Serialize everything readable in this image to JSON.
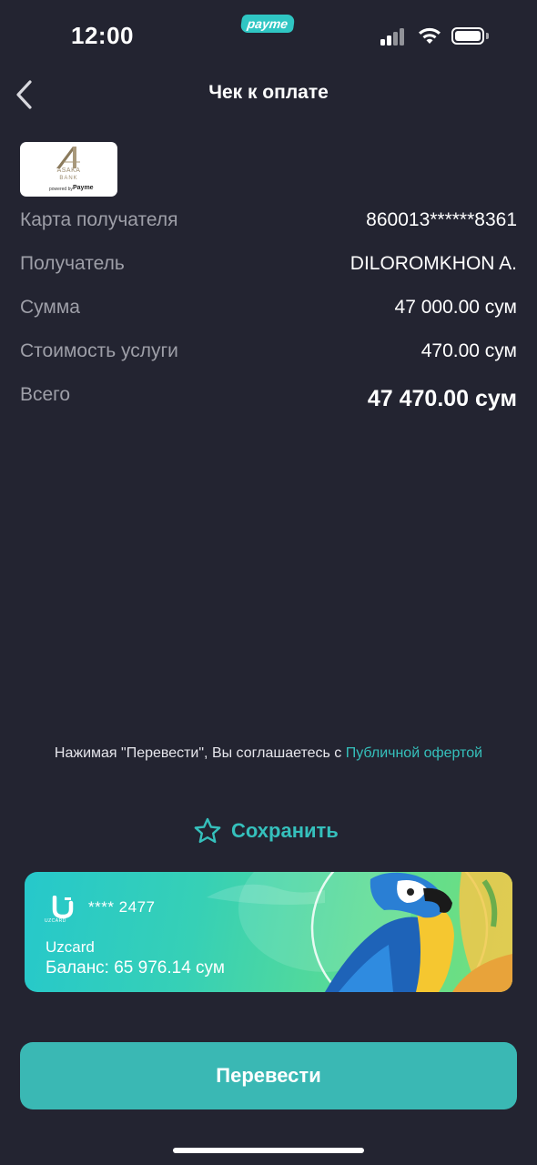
{
  "status_bar": {
    "time": "12:00",
    "badge": "payme"
  },
  "header": {
    "title": "Чек к оплате"
  },
  "bank_logo": {
    "name": "ASAKA",
    "sub": "BANK",
    "powered": "powered by",
    "pay": "Payme"
  },
  "details": [
    {
      "label": "Карта получателя",
      "value": "860013******8361"
    },
    {
      "label": "Получатель",
      "value": "DILOROMKHON A."
    },
    {
      "label": "Сумма",
      "value": "47 000.00 сум"
    },
    {
      "label": "Стоимость услуги",
      "value": "470.00 сум"
    },
    {
      "label": "Всего",
      "value": "47 470.00 сум"
    }
  ],
  "agreement": {
    "text": "Нажимая \"Перевести\", Вы соглашаетесь с ",
    "link": "Публичной офертой"
  },
  "save": {
    "label": "Сохранить"
  },
  "card": {
    "brand": "Uzcard",
    "logo_sub": "UZCARD",
    "masked_number": "**** 2477",
    "balance": "Баланс: 65 976.14 сум"
  },
  "submit": {
    "label": "Перевести"
  },
  "colors": {
    "background": "#232431",
    "accent": "#35c0bc",
    "button": "#3ab8b4",
    "muted_text": "#9e9fa8"
  }
}
